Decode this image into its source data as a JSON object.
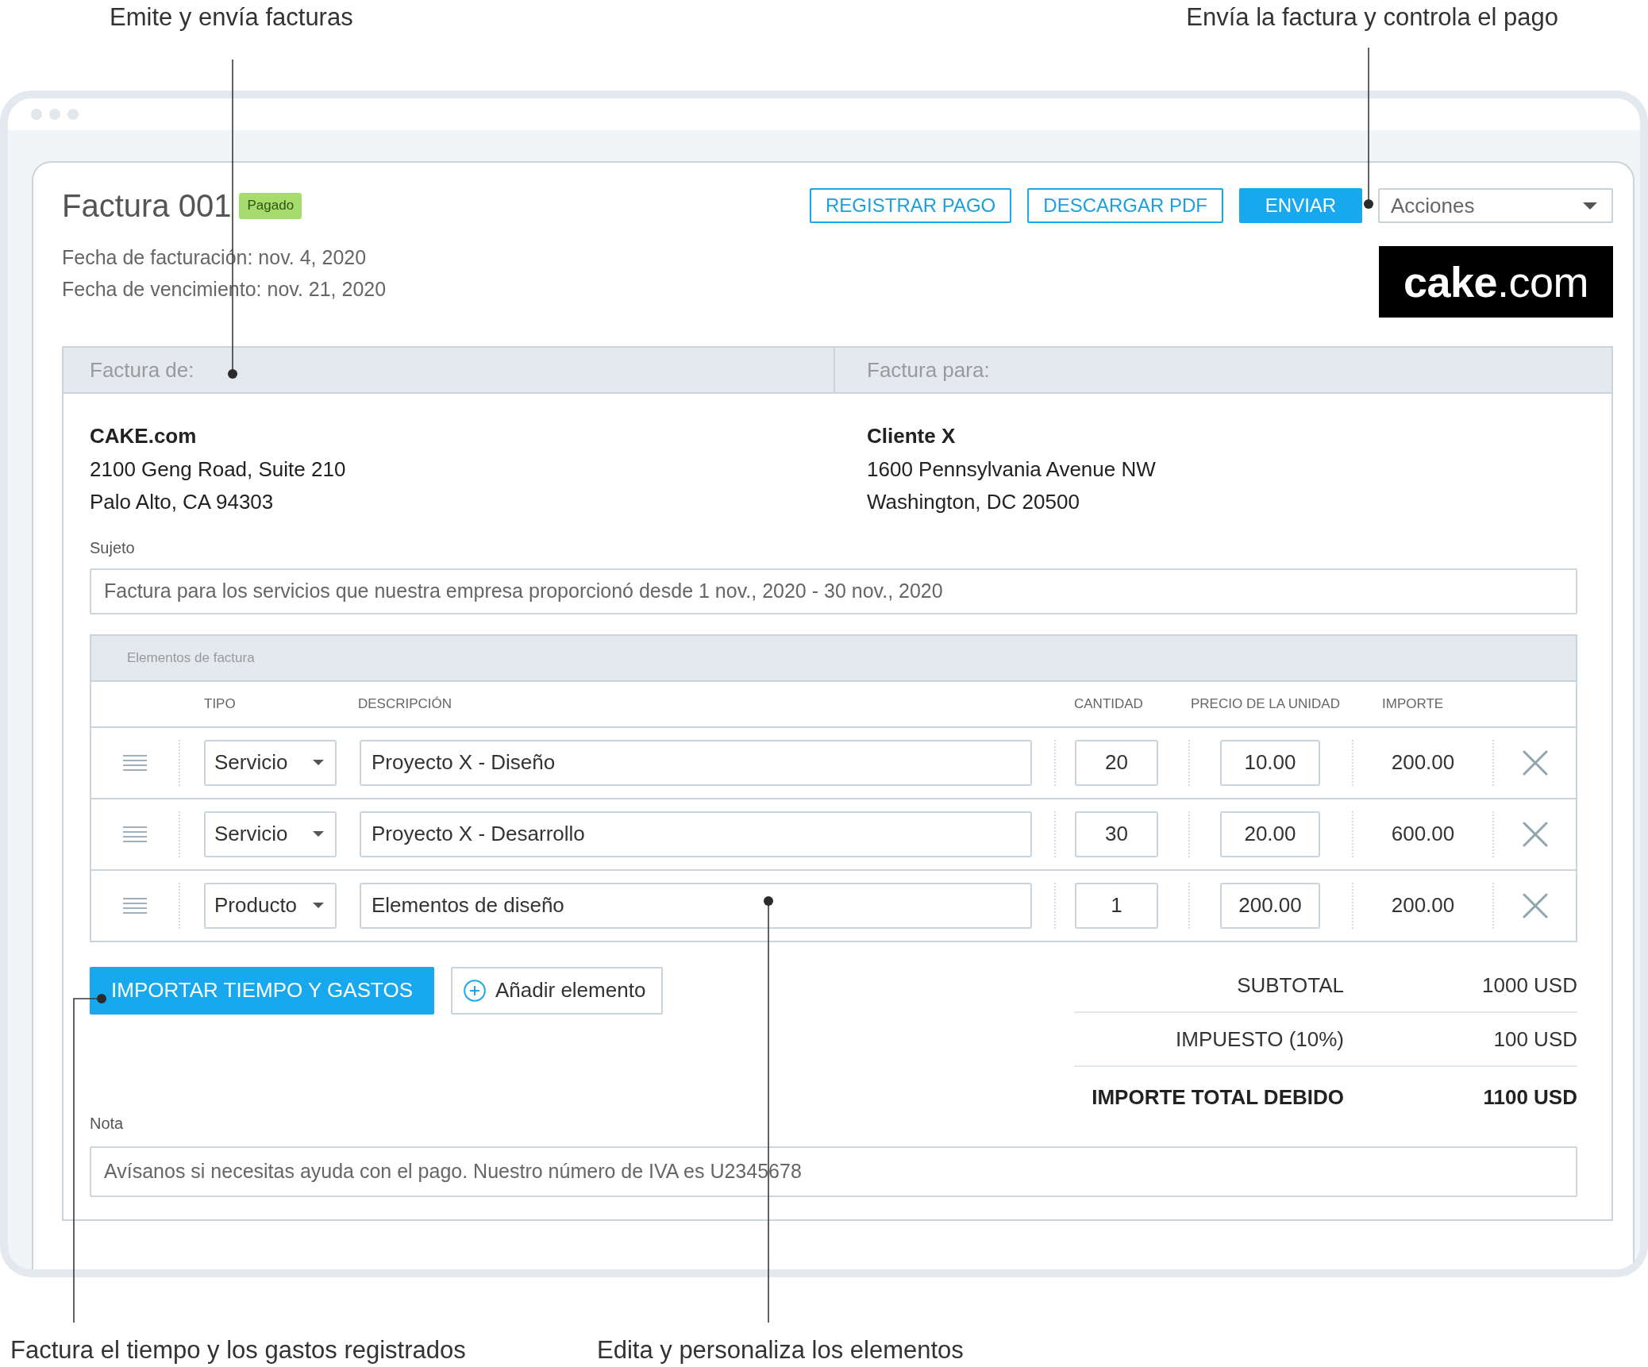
{
  "callouts_top": [
    "Emite y envía facturas",
    "Envía la factura y controla el pago"
  ],
  "invoice": {
    "title": "Factura 001",
    "status": "Pagado",
    "dates": [
      "Fecha de facturación: nov. 4, 2020",
      "Fecha de vencimiento: nov. 21, 2020"
    ]
  },
  "actions": {
    "buttons": [
      {
        "label": "REGISTRAR PAGO",
        "kind": "outline"
      },
      {
        "label": "DESCARGAR PDF",
        "kind": "outline"
      },
      {
        "label": "ENVIAR",
        "kind": "primary"
      }
    ],
    "dropdown": "Acciones"
  },
  "logo": "**cake**.com",
  "parties": [
    {
      "heading": "Factura de:",
      "name": "CAKE.com",
      "lines": [
        "2100 Geng Road, Suite 210",
        "Palo Alto, CA 94303"
      ]
    },
    {
      "heading": "Factura para:",
      "name": "Cliente X",
      "lines": [
        "1600 Pennsylvania Avenue NW",
        "Washington, DC 20500"
      ]
    }
  ],
  "subject": {
    "label": "Sujeto",
    "value": "Factura para los servicios que nuestra empresa proporcionó desde 1 nov., 2020 - 30 nov., 2020"
  },
  "items": {
    "title": "Elementos de factura",
    "columns": [
      "TIPO",
      "DESCRIPCIÓN",
      "CANTIDAD",
      "PRECIO DE LA UNIDAD",
      "IMPORTE"
    ],
    "rows": [
      {
        "type": "Servicio",
        "description": "Proyecto X - Diseño",
        "quantity": "20",
        "unit_price": "10.00",
        "amount": "200.00"
      },
      {
        "type": "Servicio",
        "description": "Proyecto X - Desarrollo",
        "quantity": "30",
        "unit_price": "20.00",
        "amount": "600.00"
      },
      {
        "type": "Producto",
        "description": "Elementos de diseño",
        "quantity": "1",
        "unit_price": "200.00",
        "amount": "200.00"
      }
    ]
  },
  "item_buttons": [
    {
      "label": "IMPORTAR TIEMPO Y GASTOS",
      "kind": "primary"
    },
    {
      "label": "Añadir elemento",
      "kind": "add"
    }
  ],
  "totals": [
    {
      "label": "SUBTOTAL",
      "value": "1000 USD",
      "emphasis": false
    },
    {
      "label": "IMPUESTO (10%)",
      "value": "100 USD",
      "emphasis": false
    },
    {
      "label": "IMPORTE TOTAL DEBIDO",
      "value": "1100 USD",
      "emphasis": true
    }
  ],
  "note": {
    "label": "Nota",
    "value": "Avísanos si necesitas ayuda con el pago. Nuestro número de IVA es U2345678"
  },
  "callouts_bottom": [
    "Factura el tiempo y los gastos registrados",
    "Edita y personaliza los elementos"
  ]
}
